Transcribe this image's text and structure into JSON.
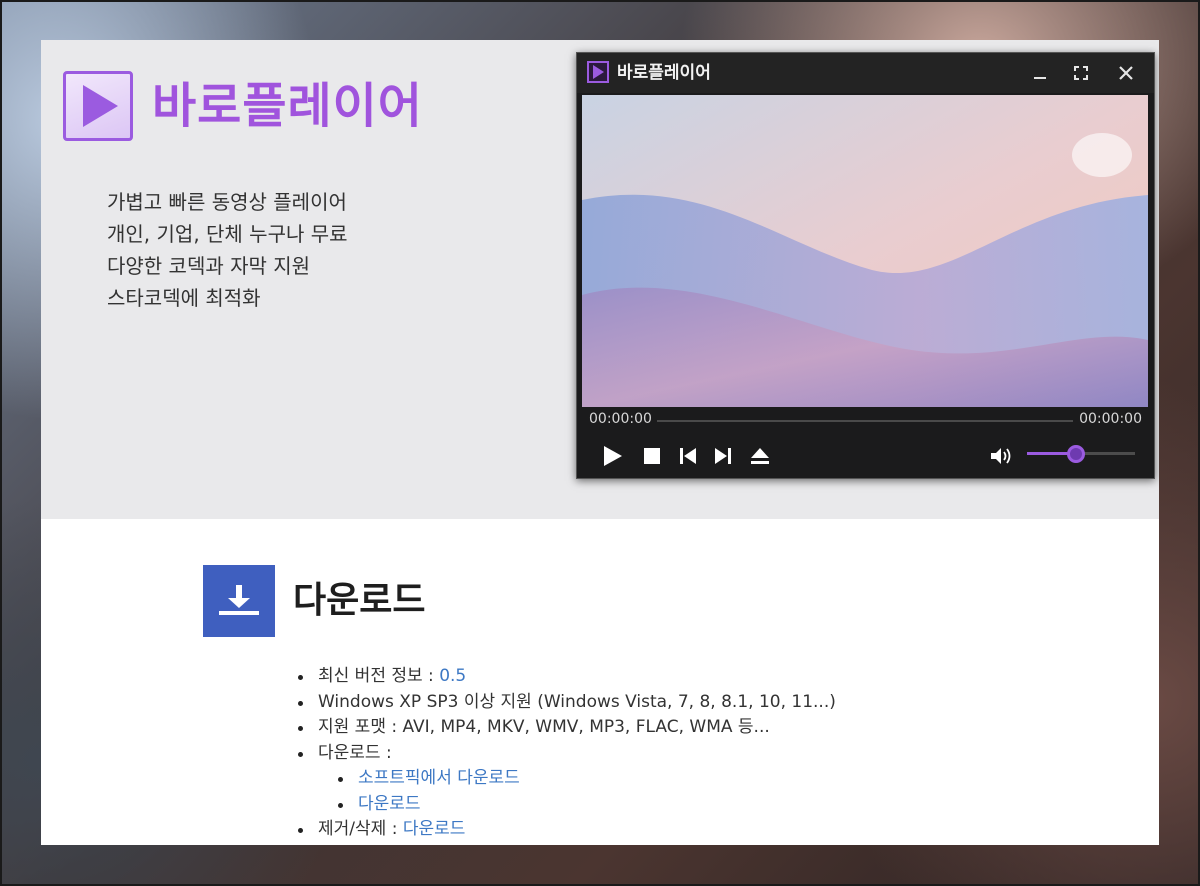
{
  "app": {
    "title": "바로플레이어",
    "features": [
      "가볍고 빠른 동영상 플레이어",
      "개인, 기업, 단체 누구나 무료",
      "다양한 코덱과 자막 지원",
      "스타코덱에 최적화"
    ]
  },
  "player": {
    "title": "바로플레이어",
    "time_elapsed": "00:00:00",
    "time_total": "00:00:00",
    "progress": 0,
    "volume": 0.45,
    "icons": {
      "minimize": "minimize-icon",
      "maximize": "maximize-icon",
      "close": "close-icon",
      "play": "play-icon",
      "stop": "stop-icon",
      "prev": "previous-icon",
      "next": "next-icon",
      "eject": "eject-icon",
      "volume": "volume-icon"
    },
    "accent": "#9b5be0"
  },
  "download": {
    "title": "다운로드",
    "version_label": "최신 버전 정보 : ",
    "version_value": "0.5",
    "os_support": "Windows XP SP3 이상 지원 (Windows Vista, 7, 8, 8.1, 10, 11...)",
    "formats": "지원 포맷 : AVI, MP4, MKV, WMV, MP3, FLAC, WMA 등...",
    "download_label": "다운로드 :",
    "links": [
      "소프트픽에서 다운로드",
      "다운로드"
    ],
    "remove_label": "제거/삭제 : ",
    "remove_link": "다운로드"
  },
  "colors": {
    "title_purple": "#a054dd",
    "download_blue": "#3f5fbf",
    "link": "#3d78c4"
  }
}
